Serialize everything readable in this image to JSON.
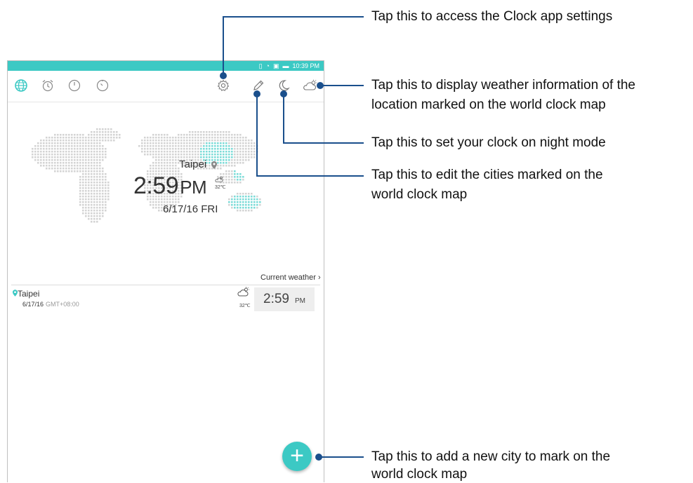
{
  "statusbar": {
    "time": "10:39 PM"
  },
  "toolbar": {
    "icons": [
      "world-clock-icon",
      "alarm-icon",
      "stopwatch-icon",
      "timer-icon",
      "settings-icon",
      "edit-icon",
      "night-mode-icon",
      "weather-icon"
    ]
  },
  "colors": {
    "accent": "#3cc9c4",
    "callout_line": "#1a4f8c"
  },
  "map": {
    "city": "Taipei",
    "time": "2:59",
    "ampm": "PM",
    "temp": "32℃",
    "date": "6/17/16 FRI"
  },
  "current_weather_link": "Current weather",
  "city_row": {
    "city": "Taipei",
    "date": "6/17/16",
    "gmt": "GMT+08:00",
    "temp": "32℃",
    "time": "2:59",
    "ampm": "PM"
  },
  "fab": {
    "label": "+"
  },
  "annotations": {
    "settings": "Tap this to access the Clock app settings",
    "weather_1": "Tap this to display weather information of the",
    "weather_2": "location marked on the world clock map",
    "night": "Tap this to set your clock on night mode",
    "edit_1": "Tap this to edit the cities marked on the",
    "edit_2": "world clock map",
    "add_1": "Tap this to add a new city to mark on the",
    "add_2": "world clock map"
  }
}
